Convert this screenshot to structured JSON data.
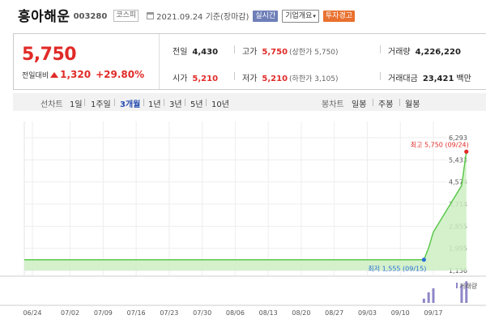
{
  "header": {
    "stock_name": "흥아해운",
    "stock_code": "003280",
    "market": "코스피",
    "date_text": "2021.09.24 기준(장마감)",
    "realtime_label": "실시간",
    "corp_label": "기업개요",
    "warn_label": "투자경고",
    "calendar_icon": "calendar-icon",
    "dropdown_icon": "chevron-down-icon"
  },
  "quote": {
    "price": "5,750",
    "change_label": "전일대비",
    "change_value": "1,320",
    "change_pct": "+29.80%",
    "prev_close_label": "전일",
    "prev_close": "4,430",
    "high_label": "고가",
    "high": "5,750",
    "upper_limit": "(상한가 5,750)",
    "volume_label": "거래량",
    "volume": "4,226,220",
    "open_label": "시가",
    "open": "5,210",
    "low_label": "저가",
    "low": "5,210",
    "lower_limit": "(하한가 3,105)",
    "amount_label": "거래대금",
    "amount": "23,421",
    "amount_unit": "백만",
    "up_color": "#e02b28"
  },
  "period_bar": {
    "line_label": "선차트",
    "periods": [
      "1일",
      "1주일",
      "3개월",
      "1년",
      "3년",
      "5년",
      "10년"
    ],
    "active_period": "3개월",
    "candle_label": "봉차트",
    "candles": [
      "일봉",
      "주봉",
      "월봉"
    ]
  },
  "chart_data": {
    "type": "area",
    "x_ticks": [
      "06/24",
      "07/02",
      "07/09",
      "07/16",
      "07/23",
      "07/30",
      "08/06",
      "08/13",
      "08/20",
      "08/27",
      "09/03",
      "09/10",
      "09/17"
    ],
    "y_ticks": [
      "6,293",
      "5,433",
      "4,574",
      "3,714",
      "2,855",
      "1,995",
      "1,136"
    ],
    "ylim": [
      1136,
      6293
    ],
    "series": [
      {
        "points": [
          [
            "06/24",
            1555
          ],
          [
            "09/14",
            1555
          ],
          [
            "09/15",
            1555
          ],
          [
            "09/16",
            2020
          ],
          [
            "09/17",
            2630
          ],
          [
            "09/23",
            4430
          ],
          [
            "09/24",
            5750
          ]
        ]
      }
    ],
    "annotations": [
      {
        "label": "최고 5,750 (09/24)",
        "x": "09/24",
        "y": 5750,
        "color": "#e02b28"
      },
      {
        "label": "최저 1,555 (09/15)",
        "x": "09/15",
        "y": 1555,
        "color": "#2a6fd6"
      }
    ],
    "volume_label": "거래량",
    "volume_bars": [
      {
        "x": "09/15",
        "value": 0.18
      },
      {
        "x": "09/16",
        "value": 0.45
      },
      {
        "x": "09/17",
        "value": 0.62
      },
      {
        "x": "09/23",
        "value": 0.78
      },
      {
        "x": "09/24",
        "value": 0.92
      }
    ],
    "line_color": "#5bc94a",
    "fill_color": "#cdeec3",
    "volume_color": "#8e86c8",
    "grid": true
  }
}
